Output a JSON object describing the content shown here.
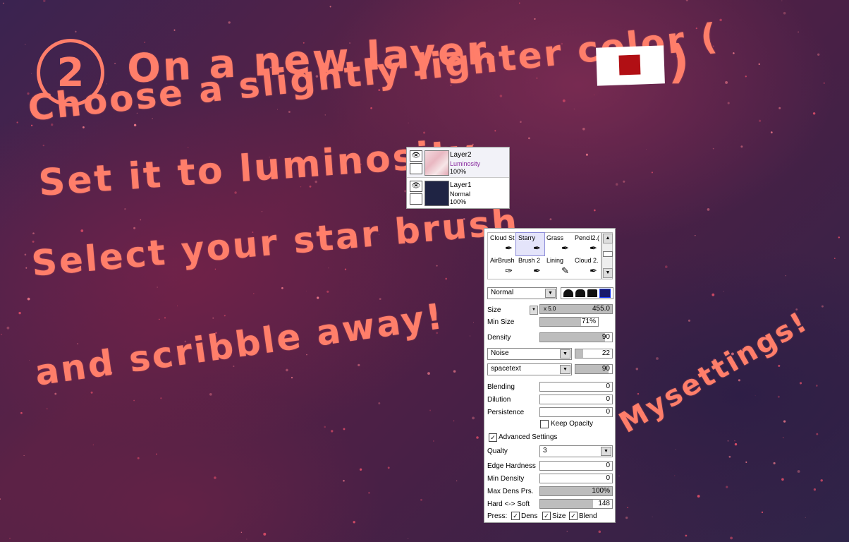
{
  "tutorial": {
    "step_number": "2",
    "line1": "On a new layer.",
    "line2": "Choose a slightly lighter color (",
    "line2_close": ")",
    "line3": "Set it to luminosity",
    "line4": "Select your star brush",
    "line5": "and scribble away!",
    "note": "Mysettings!",
    "swatch_color": "#b10f14",
    "accent_color": "#ff7e6a"
  },
  "layers": [
    {
      "name": "Layer2",
      "mode": "Luminosity",
      "opacity": "100%",
      "visible_icon": "eye-icon"
    },
    {
      "name": "Layer1",
      "mode": "Normal",
      "opacity": "100%",
      "visible_icon": "eye-icon"
    }
  ],
  "brush_panel": {
    "tools": [
      {
        "label": "Cloud St",
        "icon": "brush-icon"
      },
      {
        "label": "Starry",
        "icon": "brush-icon"
      },
      {
        "label": "Grass",
        "icon": "brush-icon"
      },
      {
        "label": "Pencil2.(",
        "icon": "brush-icon"
      },
      {
        "label": "AirBrush",
        "icon": "airbrush-icon"
      },
      {
        "label": "Brush 2",
        "icon": "brush-icon"
      },
      {
        "label": "Lining",
        "icon": "pen-icon"
      },
      {
        "label": "Cloud 2.",
        "icon": "brush-icon"
      }
    ],
    "selected_tool": "Starry",
    "blend_mode": "Normal",
    "size_label": "Size",
    "size_multiplier": "x 5.0",
    "size_value": "455.0",
    "min_size_label": "Min Size",
    "min_size_value": "71%",
    "min_size_fraction": 0.71,
    "density_label": "Density",
    "density_value": "90",
    "density_fraction": 0.9,
    "texture1_name": "Noise",
    "texture1_value": "22",
    "texture1_fraction": 0.22,
    "texture2_name": "spacetext",
    "texture2_value": "90",
    "texture2_fraction": 0.9,
    "blending_label": "Blending",
    "blending_value": "0",
    "dilution_label": "Dilution",
    "dilution_value": "0",
    "persistence_label": "Persistence",
    "persistence_value": "0",
    "keep_opacity_label": "Keep Opacity",
    "keep_opacity_checked": false,
    "advanced_label": "Advanced Settings",
    "advanced_checked": true,
    "quality_label": "Qualty",
    "quality_value": "3",
    "edge_hardness_label": "Edge Hardness",
    "edge_hardness_value": "0",
    "min_density_label": "Min Density",
    "min_density_value": "0",
    "max_dens_label": "Max Dens Prs.",
    "max_dens_value": "100%",
    "max_dens_fraction": 1.0,
    "hard_soft_label": "Hard <-> Soft",
    "hard_soft_value": "148",
    "hard_soft_fraction": 0.74,
    "press_label": "Press:",
    "press_dens_label": "Dens",
    "press_size_label": "Size",
    "press_blend_label": "Blend",
    "check_glyph": "✓"
  }
}
